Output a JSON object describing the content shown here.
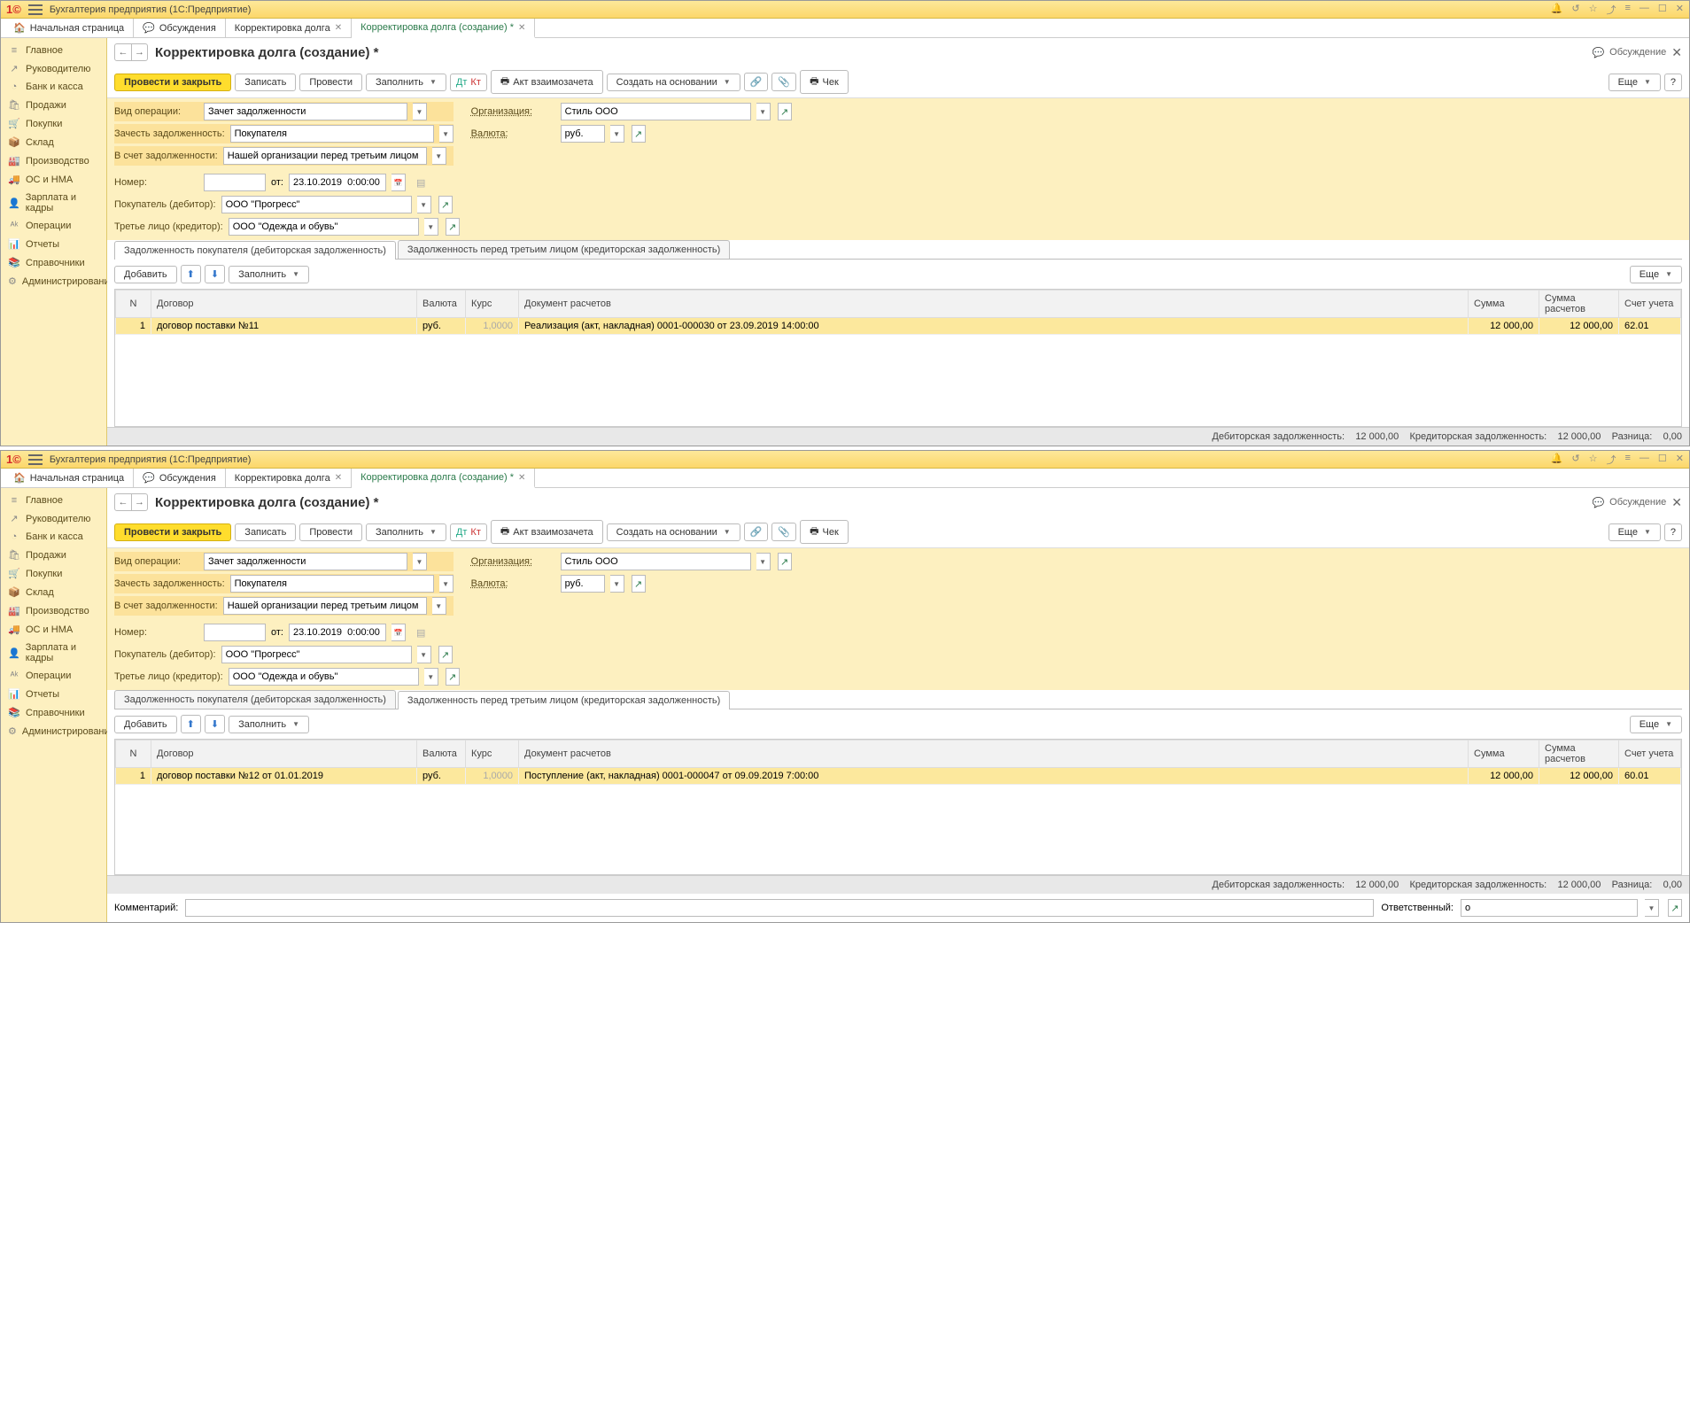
{
  "app": {
    "title": "Бухгалтерия предприятия  (1С:Предприятие)"
  },
  "tabs": {
    "home": "Начальная страница",
    "t1": "Обсуждения",
    "t2": "Корректировка долга",
    "t3": "Корректировка долга (создание) *"
  },
  "sidebar": [
    {
      "icon": "≡",
      "label": "Главное"
    },
    {
      "icon": "↗",
      "label": "Руководителю"
    },
    {
      "icon": "◔",
      "label": "Банк и касса"
    },
    {
      "icon": "🛍",
      "label": "Продажи"
    },
    {
      "icon": "🛒",
      "label": "Покупки"
    },
    {
      "icon": "📦",
      "label": "Склад"
    },
    {
      "icon": "🏭",
      "label": "Производство"
    },
    {
      "icon": "🚚",
      "label": "ОС и НМА"
    },
    {
      "icon": "👤",
      "label": "Зарплата и кадры"
    },
    {
      "icon": "ᴬᵏ",
      "label": "Операции"
    },
    {
      "icon": "📊",
      "label": "Отчеты"
    },
    {
      "icon": "📚",
      "label": "Справочники"
    },
    {
      "icon": "⚙",
      "label": "Администрирование"
    }
  ],
  "header": {
    "title": "Корректировка долга (создание) *",
    "discuss": "Обсуждение"
  },
  "toolbar": {
    "post_close": "Провести и закрыть",
    "write": "Записать",
    "post": "Провести",
    "fill": "Заполнить",
    "settle": "Акт взаимозачета",
    "create_on": "Создать на основании",
    "cheque": "Чек",
    "more": "Еще"
  },
  "form": {
    "op_type_lbl": "Вид операции:",
    "op_type": "Зачет задолженности",
    "offset_lbl": "Зачесть задолженность:",
    "offset": "Покупателя",
    "against_lbl": "В счет задолженности:",
    "against": "Нашей организации перед третьим лицом",
    "org_lbl": "Организация:",
    "org": "Стиль ООО",
    "curr_lbl": "Валюта:",
    "curr": "руб.",
    "num_lbl": "Номер:",
    "from_lbl": "от:",
    "date": "23.10.2019  0:00:00",
    "buyer_lbl": "Покупатель (дебитор):",
    "buyer": "ООО \"Прогресс\"",
    "third_lbl": "Третье лицо (кредитор):",
    "third": "ООО \"Одежда и обувь\""
  },
  "subtabs": {
    "debit": "Задолженность покупателя (дебиторская задолженность)",
    "credit": "Задолженность перед третьим лицом (кредиторская задолженность)"
  },
  "tabletools": {
    "add": "Добавить",
    "fill": "Заполнить",
    "more": "Еще"
  },
  "cols": {
    "n": "N",
    "contract": "Договор",
    "curr": "Валюта",
    "rate": "Курс",
    "doc": "Документ расчетов",
    "sum": "Сумма",
    "sum_calc": "Сумма расчетов",
    "acct": "Счет учета"
  },
  "row1": {
    "n": "1",
    "contract": "договор поставки №11",
    "curr": "руб.",
    "rate": "1,0000",
    "doc": "Реализация (акт, накладная) 0001-000030 от 23.09.2019 14:00:00",
    "sum": "12 000,00",
    "sum_calc": "12 000,00",
    "acct": "62.01"
  },
  "row2": {
    "n": "1",
    "contract": "договор поставки №12 от 01.01.2019",
    "curr": "руб.",
    "rate": "1,0000",
    "doc": "Поступление (акт, накладная) 0001-000047 от 09.09.2019 7:00:00",
    "sum": "12 000,00",
    "sum_calc": "12 000,00",
    "acct": "60.01"
  },
  "footer": {
    "debit_lbl": "Дебиторская задолженность:",
    "debit_val": "12 000,00",
    "credit_lbl": "Кредиторская задолженность:",
    "credit_val": "12 000,00",
    "diff_lbl": "Разница:",
    "diff_val": "0,00"
  },
  "bottom": {
    "comment_lbl": "Комментарий:",
    "resp_lbl": "Ответственный:",
    "resp_val": "о"
  }
}
